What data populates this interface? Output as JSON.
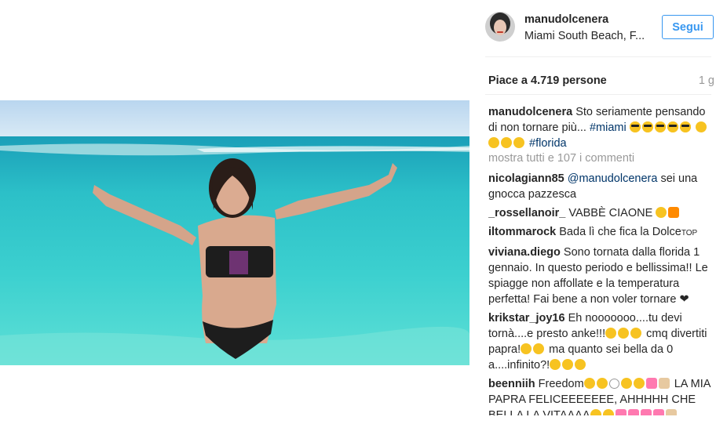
{
  "photo": {
    "alt": "beach photo"
  },
  "post": {
    "username": "manudolcenera",
    "location": "Miami South Beach, F...",
    "follow_label": "Segui",
    "likes": "Piace a 4.719 persone",
    "age": "1 g",
    "caption_text": "Sto seriamente pensando di non tornare più... ",
    "hashtag_miami": "#miami",
    "hashtag_florida": "#florida",
    "more_comments": "mostra tutti e 107 i commenti"
  },
  "comments": [
    {
      "user": "nicolagiann85",
      "mention": "@manudolcenera",
      "text": " sei una gnocca pazzesca"
    },
    {
      "user": "_rossellanoir_",
      "text": " VABBÈ CIAONE "
    },
    {
      "user": "iltommarock",
      "text": " Bada lì che fica la Dolce"
    },
    {
      "user": "viviana.diego",
      "text": " Sono tornata dalla florida 1 gennaio. In questo periodo e bellissima!! Le spiagge non affollate e la temperatura perfetta! Fai bene a non voler tornare ",
      "heart": "❤"
    },
    {
      "user": "krikstar_joy16",
      "text1": " Eh nooooooo....tu devi tornà....e presto anke!!!",
      "text2": " cmq divertiti papra!",
      "text3": " ma quanto sei bella da 0 a....infinito?!"
    },
    {
      "user": "beenniih",
      "text1": " Freedom",
      "text2": " LA MIA PAPRA FELICEEEEEEE, AHHHHH CHE BELLA LA VITAAAA"
    }
  ],
  "icons": {
    "top_badge": "TOP"
  }
}
